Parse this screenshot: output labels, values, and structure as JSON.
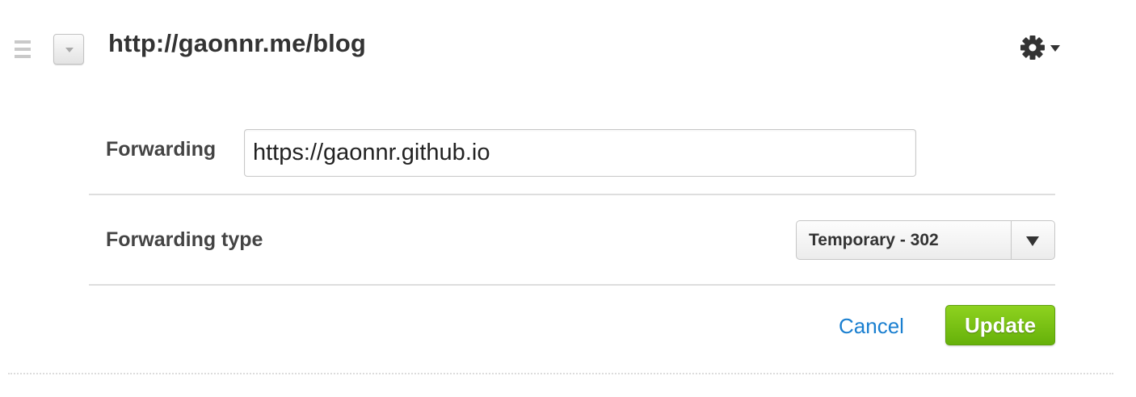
{
  "header": {
    "title": "http://gaonnr.me/blog",
    "drag_icon": "drag-handle-icon",
    "toggle_icon": "chevron-down-icon",
    "settings_icon": "gear-icon"
  },
  "forwarding": {
    "label": "Forwarding",
    "value": "https://gaonnr.github.io"
  },
  "forwarding_type": {
    "label": "Forwarding type",
    "selected": "Temporary - 302"
  },
  "actions": {
    "cancel_label": "Cancel",
    "update_label": "Update"
  },
  "colors": {
    "link": "#1a7fd0",
    "primary_button": "#7cc11a",
    "text": "#333333"
  }
}
